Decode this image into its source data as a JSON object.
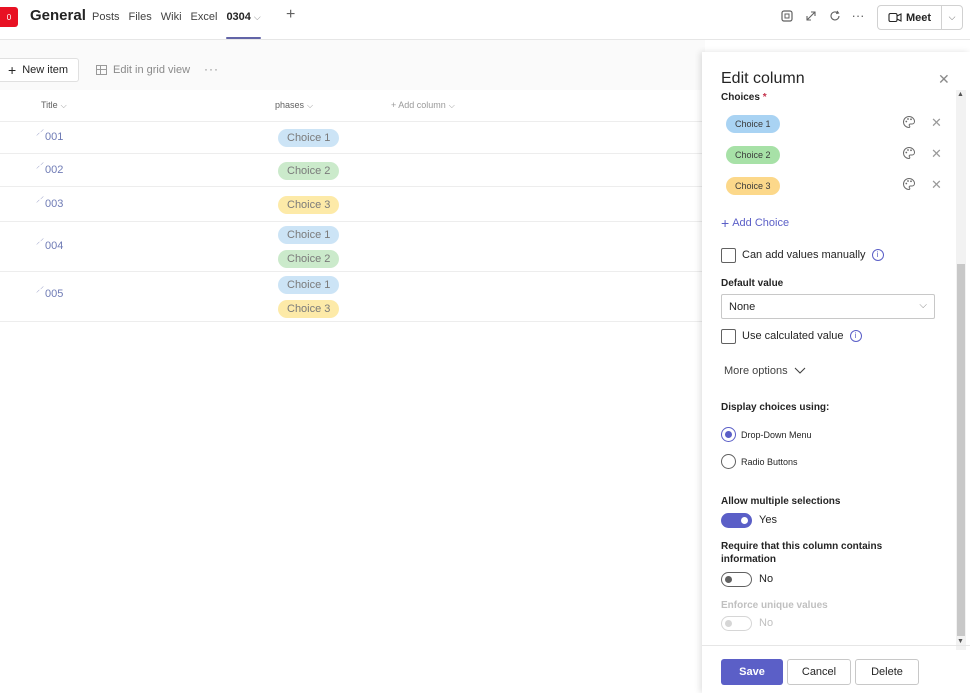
{
  "header": {
    "team_avatar_text": "0",
    "channel_name": "General",
    "tabs": [
      {
        "label": "Posts"
      },
      {
        "label": "Files"
      },
      {
        "label": "Wiki"
      },
      {
        "label": "Excel"
      },
      {
        "label": "0304"
      }
    ],
    "active_tab_chevron": "⌵",
    "add_tab": "+",
    "icons": [
      "screen-share-icon",
      "expand-icon",
      "refresh-icon",
      "more-icon"
    ],
    "meet_label": "Meet",
    "accent_color": "#6264a7",
    "brand_red": "#e81123"
  },
  "toolbar": {
    "new_item_label": "New item",
    "edit_grid_label": "Edit in grid view",
    "more_label": "···"
  },
  "list": {
    "columns": [
      "Title",
      "phases",
      "+ Add column"
    ],
    "rows": [
      {
        "title": "001",
        "phases": [
          "Choice 1"
        ]
      },
      {
        "title": "002",
        "phases": [
          "Choice 2"
        ]
      },
      {
        "title": "003",
        "phases": [
          "Choice 3"
        ]
      },
      {
        "title": "004",
        "phases": [
          "Choice 1",
          "Choice 2"
        ]
      },
      {
        "title": "005",
        "phases": [
          "Choice 1",
          "Choice 3"
        ]
      }
    ]
  },
  "panel": {
    "title": "Edit column",
    "choices_label": "Choices",
    "required_marker": "*",
    "choices": [
      {
        "label": "Choice 1",
        "color": "#a9d3f3"
      },
      {
        "label": "Choice 2",
        "color": "#a7e1a7"
      },
      {
        "label": "Choice 3",
        "color": "#fcd88a"
      }
    ],
    "add_choice_label": "Add Choice",
    "manual_values_label": "Can add values manually",
    "default_value_label": "Default value",
    "default_value": "None",
    "calculated_label": "Use calculated value",
    "more_options_label": "More options",
    "display_choices_label": "Display choices using:",
    "display_options": [
      {
        "label": "Drop-Down Menu",
        "selected": true
      },
      {
        "label": "Radio Buttons",
        "selected": false
      }
    ],
    "allow_multiple_label": "Allow multiple selections",
    "allow_multiple_value": "Yes",
    "require_label": "Require that this column contains information",
    "require_value": "No",
    "unique_label": "Enforce unique values",
    "unique_value": "No",
    "save_label": "Save",
    "cancel_label": "Cancel",
    "delete_label": "Delete"
  }
}
